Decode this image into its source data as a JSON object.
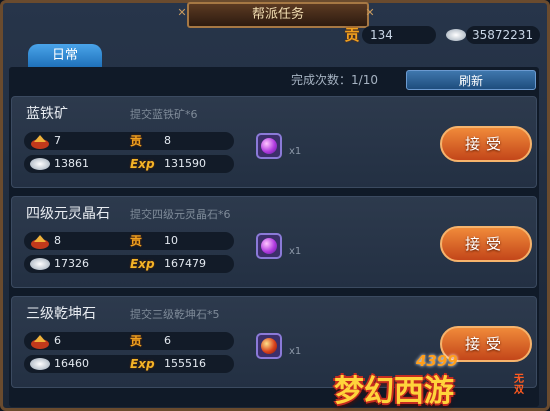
{
  "window": {
    "title": "帮派任务"
  },
  "currency": {
    "tong_value": "134",
    "silver_value": "35872231",
    "tong_icon": "贡"
  },
  "tabs": [
    {
      "label": "日常"
    }
  ],
  "progress": {
    "label": "完成次数：",
    "value": "1/10"
  },
  "refresh_label": "刷新",
  "tasks": [
    {
      "name": "蓝铁矿",
      "desc": "提交蓝铁矿*6",
      "bag": "7",
      "tong": "8",
      "silver": "13861",
      "exp": "131590",
      "reward_qty": "x1",
      "accept_label": "接受"
    },
    {
      "name": "四级元灵晶石",
      "desc": "提交四级元灵晶石*6",
      "bag": "8",
      "tong": "10",
      "silver": "17326",
      "exp": "167479",
      "reward_qty": "x1",
      "accept_label": "接受"
    },
    {
      "name": "三级乾坤石",
      "desc": "提交三级乾坤石*5",
      "bag": "6",
      "tong": "6",
      "silver": "16460",
      "exp": "155516",
      "reward_qty": "x1",
      "accept_label": "接受"
    }
  ],
  "labels": {
    "exp": "Exp",
    "tong": "贡"
  },
  "logo": {
    "brand": "4399",
    "main": "梦幻西游",
    "sub": "无双"
  },
  "colors": {
    "accept": "#e06a2a",
    "tab": "#2f89d6",
    "frame": "#6a4b2e"
  }
}
